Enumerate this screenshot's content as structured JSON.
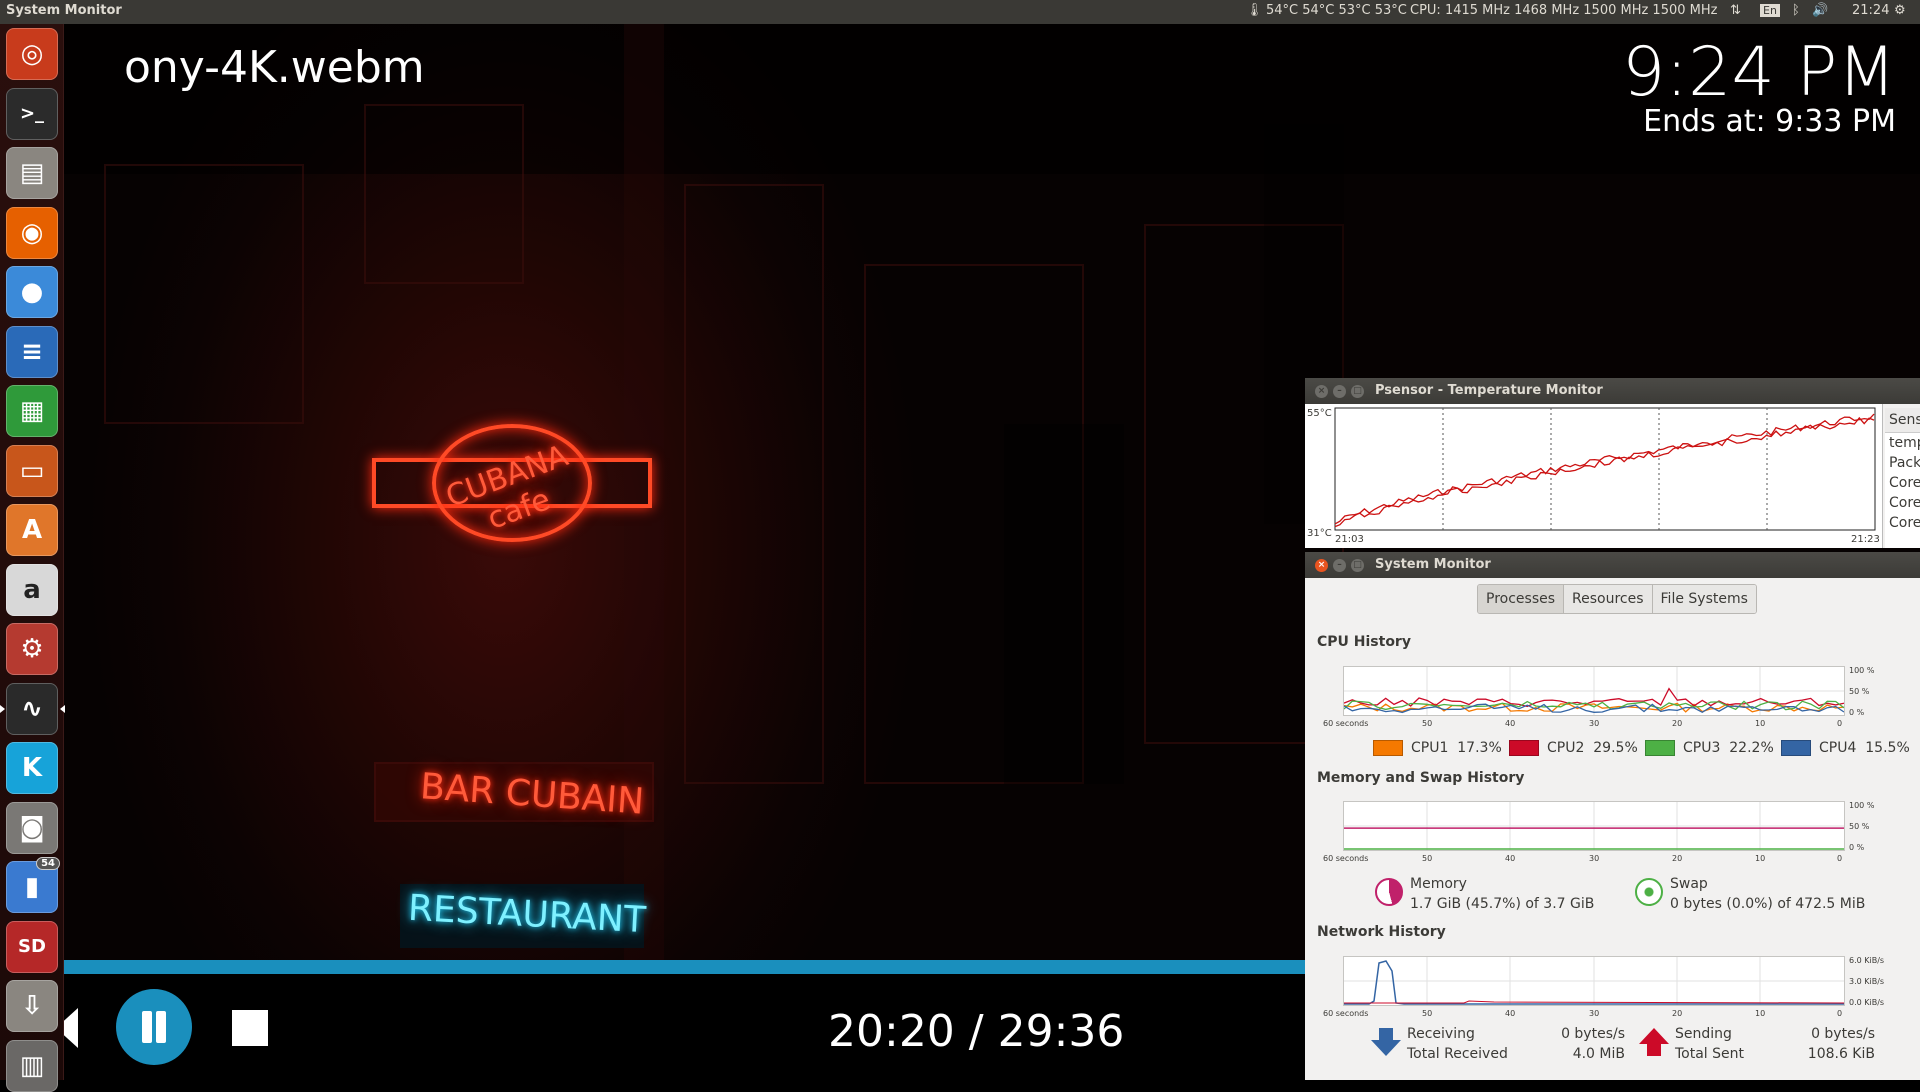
{
  "top_panel": {
    "app_title": "System Monitor",
    "temps": "54°C 54°C 53°C 53°C",
    "cpu_freq": "CPU: 1415 MHz 1468 MHz 1500 MHz 1500 MHz",
    "keyboard_layout": "En",
    "time": "21:24"
  },
  "video": {
    "title": "ony-4K.webm",
    "clock": "9:24 PM",
    "ends_at": "Ends at: 9:33 PM",
    "sign_cubana": "CUBANA cafe",
    "sign_bar": "BAR CUBAIN",
    "sign_restaurant": "RESTAURANT",
    "playback_time": "20:20 / 29:36",
    "progress_fraction": 0.686
  },
  "launcher": {
    "items": [
      {
        "name": "ubuntu-dash",
        "glyph": "◎",
        "color": "#c83b1c"
      },
      {
        "name": "terminal",
        "glyph": ">_",
        "color": "#2b2b2b"
      },
      {
        "name": "files",
        "glyph": "▤",
        "color": "#8a8680"
      },
      {
        "name": "firefox",
        "glyph": "◉",
        "color": "#e66000"
      },
      {
        "name": "chrome",
        "glyph": "●",
        "color": "#3b8ad9"
      },
      {
        "name": "writer",
        "glyph": "≡",
        "color": "#2a6ab8"
      },
      {
        "name": "calc",
        "glyph": "▦",
        "color": "#2f9a3a"
      },
      {
        "name": "impress",
        "glyph": "▭",
        "color": "#c8561b"
      },
      {
        "name": "software-center",
        "glyph": "A",
        "color": "#e0762a"
      },
      {
        "name": "amazon",
        "glyph": "a",
        "color": "#d8d8d8"
      },
      {
        "name": "system-settings",
        "glyph": "⚙",
        "color": "#b53a30"
      },
      {
        "name": "system-monitor",
        "glyph": "∿",
        "color": "#2a2a2a"
      },
      {
        "name": "kodi",
        "glyph": "K",
        "color": "#17a3d9"
      },
      {
        "name": "camera",
        "glyph": "◙",
        "color": "#7a7875"
      },
      {
        "name": "psensor",
        "glyph": "▮",
        "color": "#3a7ad0",
        "badge": "54"
      },
      {
        "name": "sd-card",
        "glyph": "SD",
        "color": "#b52828"
      },
      {
        "name": "usb",
        "glyph": "⇩",
        "color": "#8a8680"
      },
      {
        "name": "trash",
        "glyph": "▥",
        "color": "#6a6866"
      }
    ]
  },
  "psensor": {
    "title": "Psensor - Temperature Monitor",
    "y_max": "55°C",
    "y_min": "31°C",
    "x_start": "21:03",
    "x_end": "21:23",
    "sensor_header": "Sens",
    "sensors": [
      "temp",
      "Pack",
      "Core",
      "Core",
      "Core"
    ]
  },
  "sysmon": {
    "title": "System Monitor",
    "tabs": [
      "Processes",
      "Resources",
      "File Systems"
    ],
    "cpu_section": "CPU History",
    "mem_section": "Memory and Swap History",
    "net_section": "Network History",
    "x_ticks": [
      "60 seconds",
      "50",
      "40",
      "30",
      "20",
      "10",
      "0"
    ],
    "pct_ticks": [
      "100 %",
      "50 %",
      "0 %"
    ],
    "net_ticks": [
      "6.0 KiB/s",
      "3.0 KiB/s",
      "0.0 KiB/s"
    ],
    "cpus": [
      {
        "label": "CPU1",
        "value": "17.3%",
        "color": "#f57900"
      },
      {
        "label": "CPU2",
        "value": "29.5%",
        "color": "#cc0a28"
      },
      {
        "label": "CPU3",
        "value": "22.2%",
        "color": "#4db045"
      },
      {
        "label": "CPU4",
        "value": "15.5%",
        "color": "#3465a4"
      }
    ],
    "memory": {
      "label": "Memory",
      "value": "1.7 GiB (45.7%) of 3.7 GiB",
      "color": "#c0216a",
      "fraction": 0.457
    },
    "swap": {
      "label": "Swap",
      "value": "0 bytes (0.0%) of 472.5 MiB",
      "color": "#4db045",
      "fraction": 0.0
    },
    "receiving": {
      "label": "Receiving",
      "rate": "0 bytes/s",
      "total_label": "Total Received",
      "total": "4.0 MiB",
      "color": "#3465a4"
    },
    "sending": {
      "label": "Sending",
      "rate": "0 bytes/s",
      "total_label": "Total Sent",
      "total": "108.6 KiB",
      "color": "#cc0a28"
    }
  }
}
